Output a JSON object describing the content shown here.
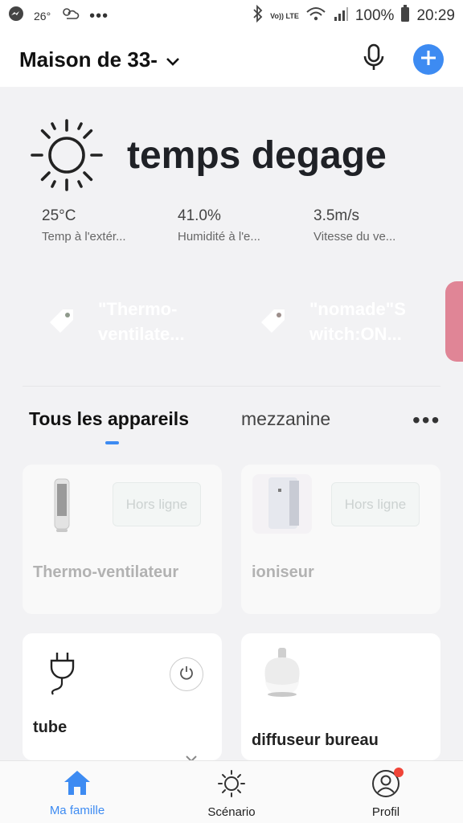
{
  "status_bar": {
    "temperature": "26°",
    "overflow": "•••",
    "network": "Vo)) LTE",
    "battery": "100%",
    "time": "20:29"
  },
  "header": {
    "home_name": "Maison de 33-",
    "mic_icon": "microphone-icon",
    "add_icon": "plus-icon",
    "accent": "#3d8bf2"
  },
  "weather": {
    "icon": "sun-icon",
    "title": "temps degage",
    "stats": [
      {
        "value": "25°C",
        "label": "Temp à l'extér..."
      },
      {
        "value": "41.0%",
        "label": "Humidité à l'e..."
      },
      {
        "value": "3.5m/s",
        "label": "Vitesse du ve..."
      }
    ]
  },
  "scenes": [
    {
      "line1": "\"Thermo-",
      "line2": "ventilate...",
      "color": "#8f9a8c"
    },
    {
      "line1": "\"nomade\"S",
      "line2": "witch:ON...",
      "color": "#9d8f8c"
    }
  ],
  "tabs": {
    "active": "Tous les appareils",
    "inactive": "mezzanine",
    "more": "•••"
  },
  "devices": [
    {
      "name": "Thermo-ventilateur",
      "status": "Hors ligne",
      "online": false
    },
    {
      "name": "ioniseur",
      "status": "Hors ligne",
      "online": false
    },
    {
      "name": "tube",
      "online": true
    },
    {
      "name": "diffuseur bureau",
      "online": true
    }
  ],
  "nav": {
    "home": "Ma famille",
    "scenario": "Scénario",
    "profile": "Profil",
    "badge_color": "#f04438"
  }
}
